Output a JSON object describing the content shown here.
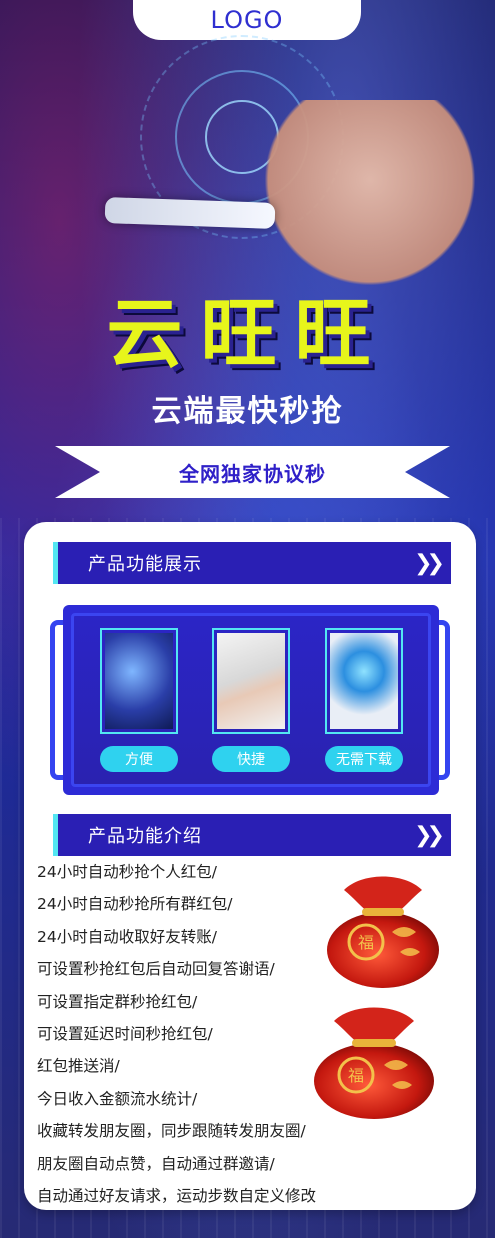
{
  "header": {
    "logo": "LOGO"
  },
  "hero": {
    "title": "云旺旺",
    "subtitle": "云端最快秒抢",
    "ribbon": "全网独家协议秒"
  },
  "section1": {
    "title": "产品功能展示",
    "items": [
      {
        "label": "方便",
        "image": "hand-holding-phone"
      },
      {
        "label": "快捷",
        "image": "typing-laptop"
      },
      {
        "label": "无需下载",
        "image": "phone-with-lens"
      }
    ]
  },
  "section2": {
    "title": "产品功能介绍",
    "features": [
      "24小时自动秒抢个人红包/",
      "24小时自动秒抢所有群红包/",
      "24小时自动收取好友转账/",
      "可设置秒抢红包后自动回复答谢语/",
      "可设置指定群秒抢红包/",
      "可设置延迟时间秒抢红包/",
      "红包推送消/",
      "今日收入金额流水统计/",
      "收藏转发朋友圈，同步跟随转发朋友圈/",
      "朋友圈自动点赞，自动通过群邀请/",
      "自动通过好友请求，运动步数自定义修改"
    ]
  },
  "colors": {
    "accent": "#2a1fb4",
    "title_yellow": "#e7f51b",
    "cyan": "#53e6f2",
    "pill": "#2fd2ef"
  },
  "icons": {
    "chevron": "double-chevron-right-icon",
    "bag": "red-lucky-bag-icon"
  }
}
